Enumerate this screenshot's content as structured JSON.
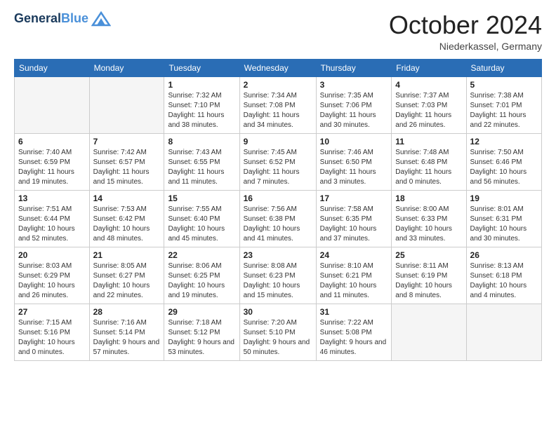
{
  "header": {
    "logo_line1": "General",
    "logo_line2": "Blue",
    "month": "October 2024",
    "location": "Niederkassel, Germany"
  },
  "weekdays": [
    "Sunday",
    "Monday",
    "Tuesday",
    "Wednesday",
    "Thursday",
    "Friday",
    "Saturday"
  ],
  "weeks": [
    [
      {
        "day": "",
        "info": ""
      },
      {
        "day": "",
        "info": ""
      },
      {
        "day": "1",
        "info": "Sunrise: 7:32 AM\nSunset: 7:10 PM\nDaylight: 11 hours and 38 minutes."
      },
      {
        "day": "2",
        "info": "Sunrise: 7:34 AM\nSunset: 7:08 PM\nDaylight: 11 hours and 34 minutes."
      },
      {
        "day": "3",
        "info": "Sunrise: 7:35 AM\nSunset: 7:06 PM\nDaylight: 11 hours and 30 minutes."
      },
      {
        "day": "4",
        "info": "Sunrise: 7:37 AM\nSunset: 7:03 PM\nDaylight: 11 hours and 26 minutes."
      },
      {
        "day": "5",
        "info": "Sunrise: 7:38 AM\nSunset: 7:01 PM\nDaylight: 11 hours and 22 minutes."
      }
    ],
    [
      {
        "day": "6",
        "info": "Sunrise: 7:40 AM\nSunset: 6:59 PM\nDaylight: 11 hours and 19 minutes."
      },
      {
        "day": "7",
        "info": "Sunrise: 7:42 AM\nSunset: 6:57 PM\nDaylight: 11 hours and 15 minutes."
      },
      {
        "day": "8",
        "info": "Sunrise: 7:43 AM\nSunset: 6:55 PM\nDaylight: 11 hours and 11 minutes."
      },
      {
        "day": "9",
        "info": "Sunrise: 7:45 AM\nSunset: 6:52 PM\nDaylight: 11 hours and 7 minutes."
      },
      {
        "day": "10",
        "info": "Sunrise: 7:46 AM\nSunset: 6:50 PM\nDaylight: 11 hours and 3 minutes."
      },
      {
        "day": "11",
        "info": "Sunrise: 7:48 AM\nSunset: 6:48 PM\nDaylight: 11 hours and 0 minutes."
      },
      {
        "day": "12",
        "info": "Sunrise: 7:50 AM\nSunset: 6:46 PM\nDaylight: 10 hours and 56 minutes."
      }
    ],
    [
      {
        "day": "13",
        "info": "Sunrise: 7:51 AM\nSunset: 6:44 PM\nDaylight: 10 hours and 52 minutes."
      },
      {
        "day": "14",
        "info": "Sunrise: 7:53 AM\nSunset: 6:42 PM\nDaylight: 10 hours and 48 minutes."
      },
      {
        "day": "15",
        "info": "Sunrise: 7:55 AM\nSunset: 6:40 PM\nDaylight: 10 hours and 45 minutes."
      },
      {
        "day": "16",
        "info": "Sunrise: 7:56 AM\nSunset: 6:38 PM\nDaylight: 10 hours and 41 minutes."
      },
      {
        "day": "17",
        "info": "Sunrise: 7:58 AM\nSunset: 6:35 PM\nDaylight: 10 hours and 37 minutes."
      },
      {
        "day": "18",
        "info": "Sunrise: 8:00 AM\nSunset: 6:33 PM\nDaylight: 10 hours and 33 minutes."
      },
      {
        "day": "19",
        "info": "Sunrise: 8:01 AM\nSunset: 6:31 PM\nDaylight: 10 hours and 30 minutes."
      }
    ],
    [
      {
        "day": "20",
        "info": "Sunrise: 8:03 AM\nSunset: 6:29 PM\nDaylight: 10 hours and 26 minutes."
      },
      {
        "day": "21",
        "info": "Sunrise: 8:05 AM\nSunset: 6:27 PM\nDaylight: 10 hours and 22 minutes."
      },
      {
        "day": "22",
        "info": "Sunrise: 8:06 AM\nSunset: 6:25 PM\nDaylight: 10 hours and 19 minutes."
      },
      {
        "day": "23",
        "info": "Sunrise: 8:08 AM\nSunset: 6:23 PM\nDaylight: 10 hours and 15 minutes."
      },
      {
        "day": "24",
        "info": "Sunrise: 8:10 AM\nSunset: 6:21 PM\nDaylight: 10 hours and 11 minutes."
      },
      {
        "day": "25",
        "info": "Sunrise: 8:11 AM\nSunset: 6:19 PM\nDaylight: 10 hours and 8 minutes."
      },
      {
        "day": "26",
        "info": "Sunrise: 8:13 AM\nSunset: 6:18 PM\nDaylight: 10 hours and 4 minutes."
      }
    ],
    [
      {
        "day": "27",
        "info": "Sunrise: 7:15 AM\nSunset: 5:16 PM\nDaylight: 10 hours and 0 minutes."
      },
      {
        "day": "28",
        "info": "Sunrise: 7:16 AM\nSunset: 5:14 PM\nDaylight: 9 hours and 57 minutes."
      },
      {
        "day": "29",
        "info": "Sunrise: 7:18 AM\nSunset: 5:12 PM\nDaylight: 9 hours and 53 minutes."
      },
      {
        "day": "30",
        "info": "Sunrise: 7:20 AM\nSunset: 5:10 PM\nDaylight: 9 hours and 50 minutes."
      },
      {
        "day": "31",
        "info": "Sunrise: 7:22 AM\nSunset: 5:08 PM\nDaylight: 9 hours and 46 minutes."
      },
      {
        "day": "",
        "info": ""
      },
      {
        "day": "",
        "info": ""
      }
    ]
  ]
}
